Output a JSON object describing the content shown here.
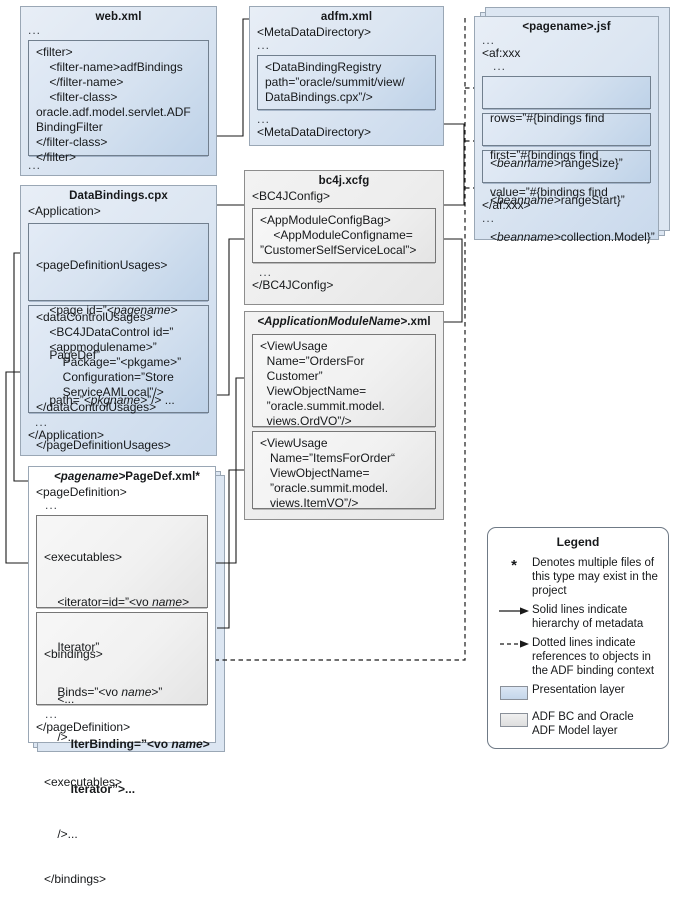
{
  "boxes": {
    "web_xml": {
      "title": "web.xml",
      "top_dots": "...",
      "bottom_dots": "...",
      "code": "<filter>\n    <filter-name>adfBindings\n    </filter-name>\n    <filter-class>\noracle.adf.model.servlet.ADF\nBindingFilter\n</filter-class>\n</filter>"
    },
    "adfm_xml": {
      "title": "adfm.xml",
      "line_open": "<MetaDataDirectory>",
      "dots_1": "...",
      "dots_2": "...",
      "line_close": "<MetaDataDirectory>",
      "code": "<DataBindingRegistry\npath=”oracle/summit/view/\nDataBindings.cpx”/>"
    },
    "pagename_jsf": {
      "title": "<pagename>.jsf",
      "dots_1": "...",
      "line_af_open": "<af:xxx",
      "dots_2": "...",
      "dots_3": "...",
      "line_af_close": "</af:xxx>",
      "dots_4": "...",
      "rows_a": "rows=”#{bindings find",
      "rows_b_it": "<beanname>",
      "rows_b": "rangeSize}”",
      "first_a": "first=”#{bindings find",
      "first_b_it": "<beanname>",
      "first_b": "rangeStart}”",
      "value_a": "value=”#{bindings find",
      "value_b_it": "<beanname>",
      "value_b": "collection.Model}”"
    },
    "databindings_cpx": {
      "title": "DataBindings.cpx",
      "line_open": "<Application>",
      "dots": "...",
      "line_close": "</Application>",
      "code_1_l1": "<pageDefinitionUsages>",
      "code_1_l2a": "    <page id=”",
      "code_1_l2b_it": "<pagename>",
      "code_1_l3": "    PageDef”",
      "code_1_l4a": "    path=”",
      "code_1_l4b_it": "<pkgname>",
      "code_1_l4c": "”/> ...",
      "code_1_l5": "</pageDefinitionUsages>",
      "code_2": "<dataControlUsages>\n    <BC4JDataControl id=”\n    <appmodulename>”\n        Package=”<pkgame>”\n        Configuration=”Store\n        ServiceAMLocal”/>\n</dataControlUsages>"
    },
    "bc4j_xcfg": {
      "title": "bc4j.xcfg",
      "line_open": "<BC4JConfig>",
      "dots": "...",
      "line_close": "</BC4JConfig>",
      "code": "<AppModuleConfigBag>\n    <AppModuleConfigname=\n”CustomerSelfServiceLocal”>"
    },
    "appmodule_xml": {
      "title_it": "<ApplicationModuleName>",
      "title_rest": ".xml",
      "code_1": "<ViewUsage\n  Name=”OrdersFor\n  Customer”\n  ViewObjectName=\n  ”oracle.summit.model.\n  views.OrdVO”/>",
      "code_2": "<ViewUsage\n   Name=”ItemsForOrder“\n   ViewObjectName=\n   ”oracle.summit.model.\n   views.ItemVO”/>"
    },
    "pagedef_xml": {
      "title_it": "<pagename>",
      "title_rest": "PageDef.xml*",
      "line_open": "<pageDefinition>",
      "dots_1": "...",
      "dots_2": "...",
      "line_close": "</pageDefinition>",
      "exec_l1": "<executables>",
      "exec_l2a": "    <iterator=id=”<vo ",
      "exec_l2b_it": "name",
      "exec_l2c": ">",
      "exec_l3": "    Iterator”",
      "exec_l4a": "    Binds=”<vo ",
      "exec_l4b_it": "name",
      "exec_l4c": ">”",
      "exec_l5": "    />...",
      "exec_l6": "<executables>",
      "bind_l1": "<bindings>",
      "bind_l2": "    <...",
      "bind_l3a": "        IterBinding=”<vo ",
      "bind_l3b_it": "name",
      "bind_l3c": ">",
      "bind_l4": "        Iterator”>...",
      "bind_l5": "    />...",
      "bind_l6": "</bindings>"
    }
  },
  "legend": {
    "title": "Legend",
    "items": [
      {
        "symbol": "asterisk",
        "text": "Denotes multiple files of this type may exist in the project"
      },
      {
        "symbol": "solid-arrow",
        "text": "Solid lines indicate hierarchy of metadata"
      },
      {
        "symbol": "dotted-arrow",
        "text": "Dotted lines indicate references to objects in the ADF binding context"
      },
      {
        "symbol": "blue-swatch",
        "text": "Presentation layer"
      },
      {
        "symbol": "grey-swatch",
        "text": "ADF BC and Oracle ADF Model layer"
      }
    ]
  },
  "colors": {
    "presentation_layer": "#c9d9ec",
    "model_layer": "#ececec",
    "line": "#1a1a1a"
  }
}
